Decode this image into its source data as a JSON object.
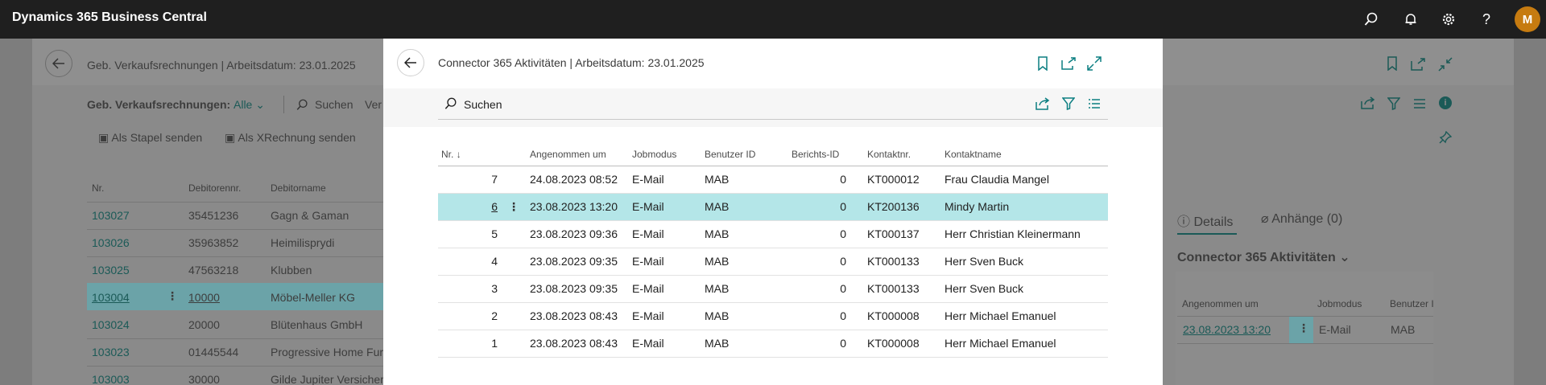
{
  "app": {
    "title": "Dynamics 365 Business Central",
    "user_initial": "M",
    "icons": [
      "search-icon",
      "bell-icon",
      "gear-icon",
      "help-icon"
    ]
  },
  "background_page": {
    "title": "Geb. Verkaufsrechnungen | Arbeitsdatum: 23.01.2025",
    "filter_label": "Geb. Verkaufsrechnungen:",
    "filter_value": "Alle",
    "search_label": "Suchen",
    "truncated_action": "Ver",
    "actions": [
      "Als Stapel senden",
      "Als XRechnung senden"
    ],
    "columns": [
      "Nr.",
      "Debitorennr.",
      "Debitorname"
    ],
    "rows": [
      {
        "nr": "103027",
        "debnr": "35451236",
        "name": "Gagn & Gaman"
      },
      {
        "nr": "103026",
        "debnr": "35963852",
        "name": "Heimilisprydi"
      },
      {
        "nr": "103025",
        "debnr": "47563218",
        "name": "Klubben"
      },
      {
        "nr": "103004",
        "debnr": "10000",
        "name": "Möbel-Meller KG"
      },
      {
        "nr": "103024",
        "debnr": "20000",
        "name": "Blütenhaus GmbH"
      },
      {
        "nr": "103023",
        "debnr": "01445544",
        "name": "Progressive Home Furn"
      },
      {
        "nr": "103003",
        "debnr": "30000",
        "name": "Gilde Jupiter Versicher"
      }
    ],
    "factbox": {
      "tab_details": "Details",
      "tab_attachments": "Anhänge (0)",
      "section_title": "Connector 365 Aktivitäten",
      "columns": [
        "Angenommen um",
        "Jobmodus",
        "Benutzer II"
      ],
      "row": {
        "date": "23.08.2023 13:20",
        "mode": "E-Mail",
        "user": "MAB"
      }
    }
  },
  "modal": {
    "title": "Connector 365 Aktivitäten | Arbeitsdatum: 23.01.2025",
    "search_label": "Suchen",
    "columns": {
      "nr": "Nr.",
      "sort_arrow": "↓",
      "accepted": "Angenommen um",
      "mode": "Jobmodus",
      "user": "Benutzer ID",
      "report": "Berichts-ID",
      "contact_no": "Kontaktnr.",
      "contact_name": "Kontaktname"
    },
    "rows": [
      {
        "nr": "7",
        "accepted": "24.08.2023 08:52",
        "mode": "E-Mail",
        "user": "MAB",
        "report": "0",
        "contact_no": "KT000012",
        "contact_name": "Frau Claudia Mangel"
      },
      {
        "nr": "6",
        "accepted": "23.08.2023 13:20",
        "mode": "E-Mail",
        "user": "MAB",
        "report": "0",
        "contact_no": "KT200136",
        "contact_name": "Mindy Martin"
      },
      {
        "nr": "5",
        "accepted": "23.08.2023 09:36",
        "mode": "E-Mail",
        "user": "MAB",
        "report": "0",
        "contact_no": "KT000137",
        "contact_name": "Herr Christian Kleinermann"
      },
      {
        "nr": "4",
        "accepted": "23.08.2023 09:35",
        "mode": "E-Mail",
        "user": "MAB",
        "report": "0",
        "contact_no": "KT000133",
        "contact_name": "Herr Sven Buck"
      },
      {
        "nr": "3",
        "accepted": "23.08.2023 09:35",
        "mode": "E-Mail",
        "user": "MAB",
        "report": "0",
        "contact_no": "KT000133",
        "contact_name": "Herr Sven Buck"
      },
      {
        "nr": "2",
        "accepted": "23.08.2023 08:43",
        "mode": "E-Mail",
        "user": "MAB",
        "report": "0",
        "contact_no": "KT000008",
        "contact_name": "Herr Michael Emanuel"
      },
      {
        "nr": "1",
        "accepted": "23.08.2023 08:43",
        "mode": "E-Mail",
        "user": "MAB",
        "report": "0",
        "contact_no": "KT000008",
        "contact_name": "Herr Michael Emanuel"
      }
    ],
    "selected_row_index": 1,
    "row_menu_glyph": "⋮"
  },
  "colors": {
    "accent": "#0b7e81",
    "selected_row": "#b4e6e8",
    "topbar": "#1f1f1f",
    "avatar": "#c67b10"
  }
}
